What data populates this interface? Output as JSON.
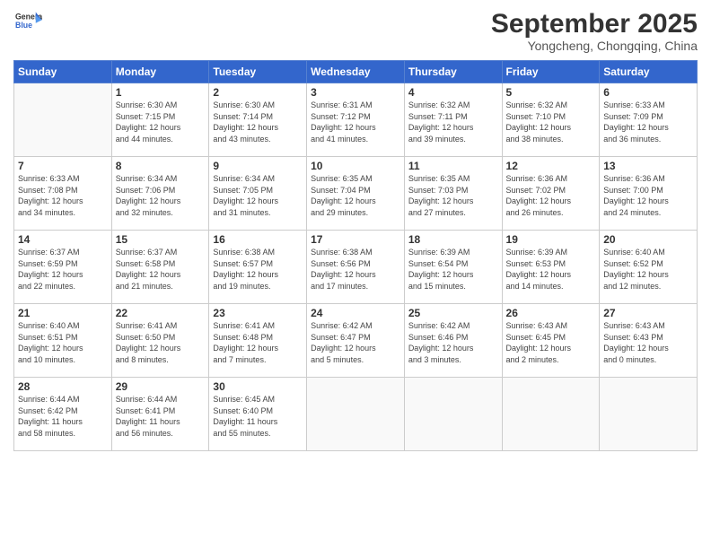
{
  "header": {
    "logo_line1": "General",
    "logo_line2": "Blue",
    "month": "September 2025",
    "location": "Yongcheng, Chongqing, China"
  },
  "weekdays": [
    "Sunday",
    "Monday",
    "Tuesday",
    "Wednesday",
    "Thursday",
    "Friday",
    "Saturday"
  ],
  "weeks": [
    [
      {
        "day": "",
        "info": ""
      },
      {
        "day": "1",
        "info": "Sunrise: 6:30 AM\nSunset: 7:15 PM\nDaylight: 12 hours\nand 44 minutes."
      },
      {
        "day": "2",
        "info": "Sunrise: 6:30 AM\nSunset: 7:14 PM\nDaylight: 12 hours\nand 43 minutes."
      },
      {
        "day": "3",
        "info": "Sunrise: 6:31 AM\nSunset: 7:12 PM\nDaylight: 12 hours\nand 41 minutes."
      },
      {
        "day": "4",
        "info": "Sunrise: 6:32 AM\nSunset: 7:11 PM\nDaylight: 12 hours\nand 39 minutes."
      },
      {
        "day": "5",
        "info": "Sunrise: 6:32 AM\nSunset: 7:10 PM\nDaylight: 12 hours\nand 38 minutes."
      },
      {
        "day": "6",
        "info": "Sunrise: 6:33 AM\nSunset: 7:09 PM\nDaylight: 12 hours\nand 36 minutes."
      }
    ],
    [
      {
        "day": "7",
        "info": "Sunrise: 6:33 AM\nSunset: 7:08 PM\nDaylight: 12 hours\nand 34 minutes."
      },
      {
        "day": "8",
        "info": "Sunrise: 6:34 AM\nSunset: 7:06 PM\nDaylight: 12 hours\nand 32 minutes."
      },
      {
        "day": "9",
        "info": "Sunrise: 6:34 AM\nSunset: 7:05 PM\nDaylight: 12 hours\nand 31 minutes."
      },
      {
        "day": "10",
        "info": "Sunrise: 6:35 AM\nSunset: 7:04 PM\nDaylight: 12 hours\nand 29 minutes."
      },
      {
        "day": "11",
        "info": "Sunrise: 6:35 AM\nSunset: 7:03 PM\nDaylight: 12 hours\nand 27 minutes."
      },
      {
        "day": "12",
        "info": "Sunrise: 6:36 AM\nSunset: 7:02 PM\nDaylight: 12 hours\nand 26 minutes."
      },
      {
        "day": "13",
        "info": "Sunrise: 6:36 AM\nSunset: 7:00 PM\nDaylight: 12 hours\nand 24 minutes."
      }
    ],
    [
      {
        "day": "14",
        "info": "Sunrise: 6:37 AM\nSunset: 6:59 PM\nDaylight: 12 hours\nand 22 minutes."
      },
      {
        "day": "15",
        "info": "Sunrise: 6:37 AM\nSunset: 6:58 PM\nDaylight: 12 hours\nand 21 minutes."
      },
      {
        "day": "16",
        "info": "Sunrise: 6:38 AM\nSunset: 6:57 PM\nDaylight: 12 hours\nand 19 minutes."
      },
      {
        "day": "17",
        "info": "Sunrise: 6:38 AM\nSunset: 6:56 PM\nDaylight: 12 hours\nand 17 minutes."
      },
      {
        "day": "18",
        "info": "Sunrise: 6:39 AM\nSunset: 6:54 PM\nDaylight: 12 hours\nand 15 minutes."
      },
      {
        "day": "19",
        "info": "Sunrise: 6:39 AM\nSunset: 6:53 PM\nDaylight: 12 hours\nand 14 minutes."
      },
      {
        "day": "20",
        "info": "Sunrise: 6:40 AM\nSunset: 6:52 PM\nDaylight: 12 hours\nand 12 minutes."
      }
    ],
    [
      {
        "day": "21",
        "info": "Sunrise: 6:40 AM\nSunset: 6:51 PM\nDaylight: 12 hours\nand 10 minutes."
      },
      {
        "day": "22",
        "info": "Sunrise: 6:41 AM\nSunset: 6:50 PM\nDaylight: 12 hours\nand 8 minutes."
      },
      {
        "day": "23",
        "info": "Sunrise: 6:41 AM\nSunset: 6:48 PM\nDaylight: 12 hours\nand 7 minutes."
      },
      {
        "day": "24",
        "info": "Sunrise: 6:42 AM\nSunset: 6:47 PM\nDaylight: 12 hours\nand 5 minutes."
      },
      {
        "day": "25",
        "info": "Sunrise: 6:42 AM\nSunset: 6:46 PM\nDaylight: 12 hours\nand 3 minutes."
      },
      {
        "day": "26",
        "info": "Sunrise: 6:43 AM\nSunset: 6:45 PM\nDaylight: 12 hours\nand 2 minutes."
      },
      {
        "day": "27",
        "info": "Sunrise: 6:43 AM\nSunset: 6:43 PM\nDaylight: 12 hours\nand 0 minutes."
      }
    ],
    [
      {
        "day": "28",
        "info": "Sunrise: 6:44 AM\nSunset: 6:42 PM\nDaylight: 11 hours\nand 58 minutes."
      },
      {
        "day": "29",
        "info": "Sunrise: 6:44 AM\nSunset: 6:41 PM\nDaylight: 11 hours\nand 56 minutes."
      },
      {
        "day": "30",
        "info": "Sunrise: 6:45 AM\nSunset: 6:40 PM\nDaylight: 11 hours\nand 55 minutes."
      },
      {
        "day": "",
        "info": ""
      },
      {
        "day": "",
        "info": ""
      },
      {
        "day": "",
        "info": ""
      },
      {
        "day": "",
        "info": ""
      }
    ]
  ]
}
